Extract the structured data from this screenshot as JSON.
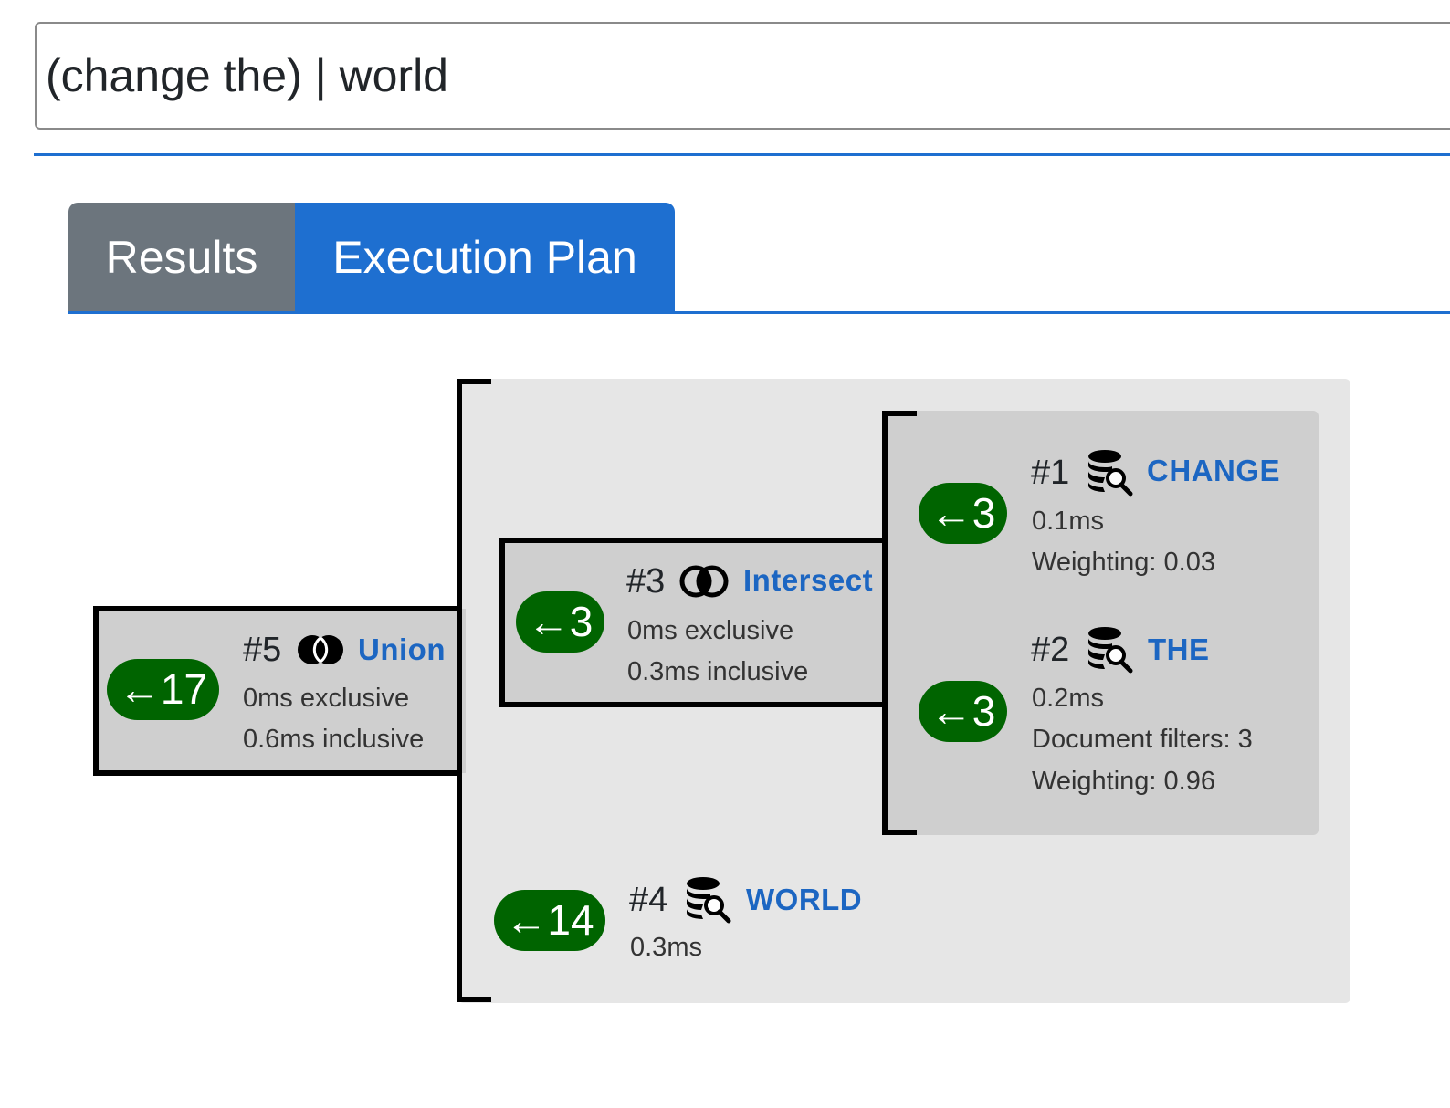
{
  "search": {
    "query": "(change the) | world"
  },
  "tabs": [
    {
      "label": "Results",
      "active": false
    },
    {
      "label": "Execution Plan",
      "active": true
    }
  ],
  "colors": {
    "accent": "#1e6fd0",
    "badge": "#006400",
    "link": "#1c66c2",
    "inactive_tab": "#6c757d"
  },
  "plan": {
    "nodes": {
      "n5": {
        "id": "#5",
        "icon": "union-icon",
        "name": "Union",
        "count": "←17",
        "stats": [
          "0ms exclusive",
          "0.6ms inclusive"
        ]
      },
      "n3": {
        "id": "#3",
        "icon": "intersect-icon",
        "name": "Intersect",
        "count": "←3",
        "stats": [
          "0ms exclusive",
          "0.3ms inclusive"
        ]
      },
      "n1": {
        "id": "#1",
        "icon": "database-search-icon",
        "name": "CHANGE",
        "count": "←3",
        "stats": [
          "0.1ms",
          "Weighting: 0.03"
        ]
      },
      "n2": {
        "id": "#2",
        "icon": "database-search-icon",
        "name": "THE",
        "count": "←3",
        "stats": [
          "0.2ms",
          "Document filters: 3",
          "Weighting: 0.96"
        ]
      },
      "n4": {
        "id": "#4",
        "icon": "database-search-icon",
        "name": "WORLD",
        "count": "←14",
        "stats": [
          "0.3ms"
        ]
      }
    }
  }
}
